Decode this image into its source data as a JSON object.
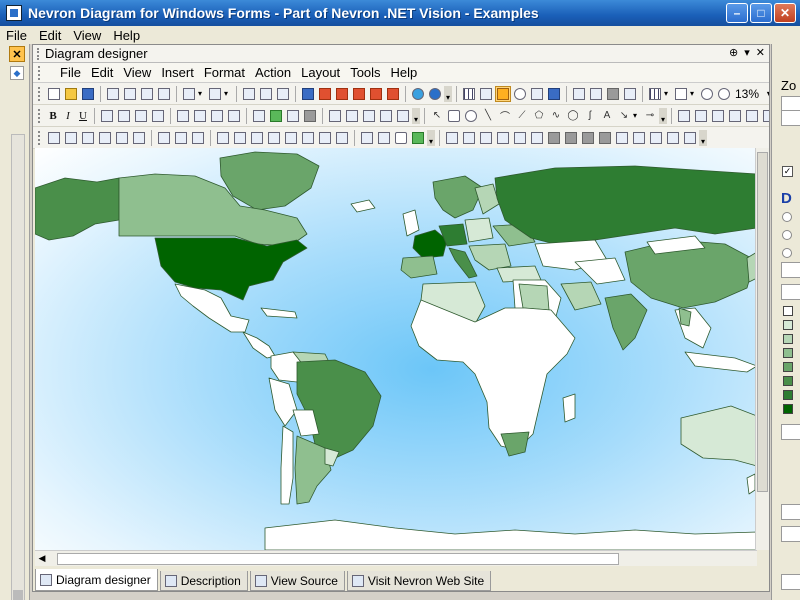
{
  "window": {
    "title": "Nevron Diagram for Windows Forms - Part of Nevron .NET Vision - Examples",
    "min_label": "–",
    "max_label": "□",
    "close_label": "✕"
  },
  "main_menu": [
    "File",
    "Edit",
    "View",
    "Help"
  ],
  "left_strip": {
    "close_label": "✕",
    "item_label": "◆"
  },
  "panel": {
    "title": "Diagram designer",
    "pin_label": "⊕",
    "dropdown_label": "▾",
    "close_label": "✕",
    "menu": [
      "File",
      "Edit",
      "View",
      "Insert",
      "Format",
      "Action",
      "Layout",
      "Tools",
      "Help"
    ],
    "text_tools": [
      "B",
      "I",
      "U"
    ],
    "text_tool_label": "A",
    "zoom": "13%"
  },
  "tabs": [
    {
      "label": "Diagram designer",
      "icon": "diagram-icon",
      "active": true
    },
    {
      "label": "Description",
      "icon": "description-icon",
      "active": false
    },
    {
      "label": "View Source",
      "icon": "source-icon",
      "active": false
    },
    {
      "label": "Visit Nevron Web Site",
      "icon": "web-icon",
      "active": false
    }
  ],
  "right_panel": {
    "label": "Zo",
    "heading": "D",
    "checkbox_mark": "✓"
  },
  "map": {
    "ocean_colors": [
      "#6cc6f8",
      "#ffffff"
    ],
    "land_default": "#ffffff",
    "border_color": "#2f5a2f",
    "palette": [
      "#006400",
      "#2e7d32",
      "#4a8f4a",
      "#6aa56a",
      "#8fbf8f",
      "#b5d6b5",
      "#d6e9d6"
    ]
  },
  "colors": {
    "title_bar": "#1a5fb8",
    "chrome": "#ece9d8"
  }
}
